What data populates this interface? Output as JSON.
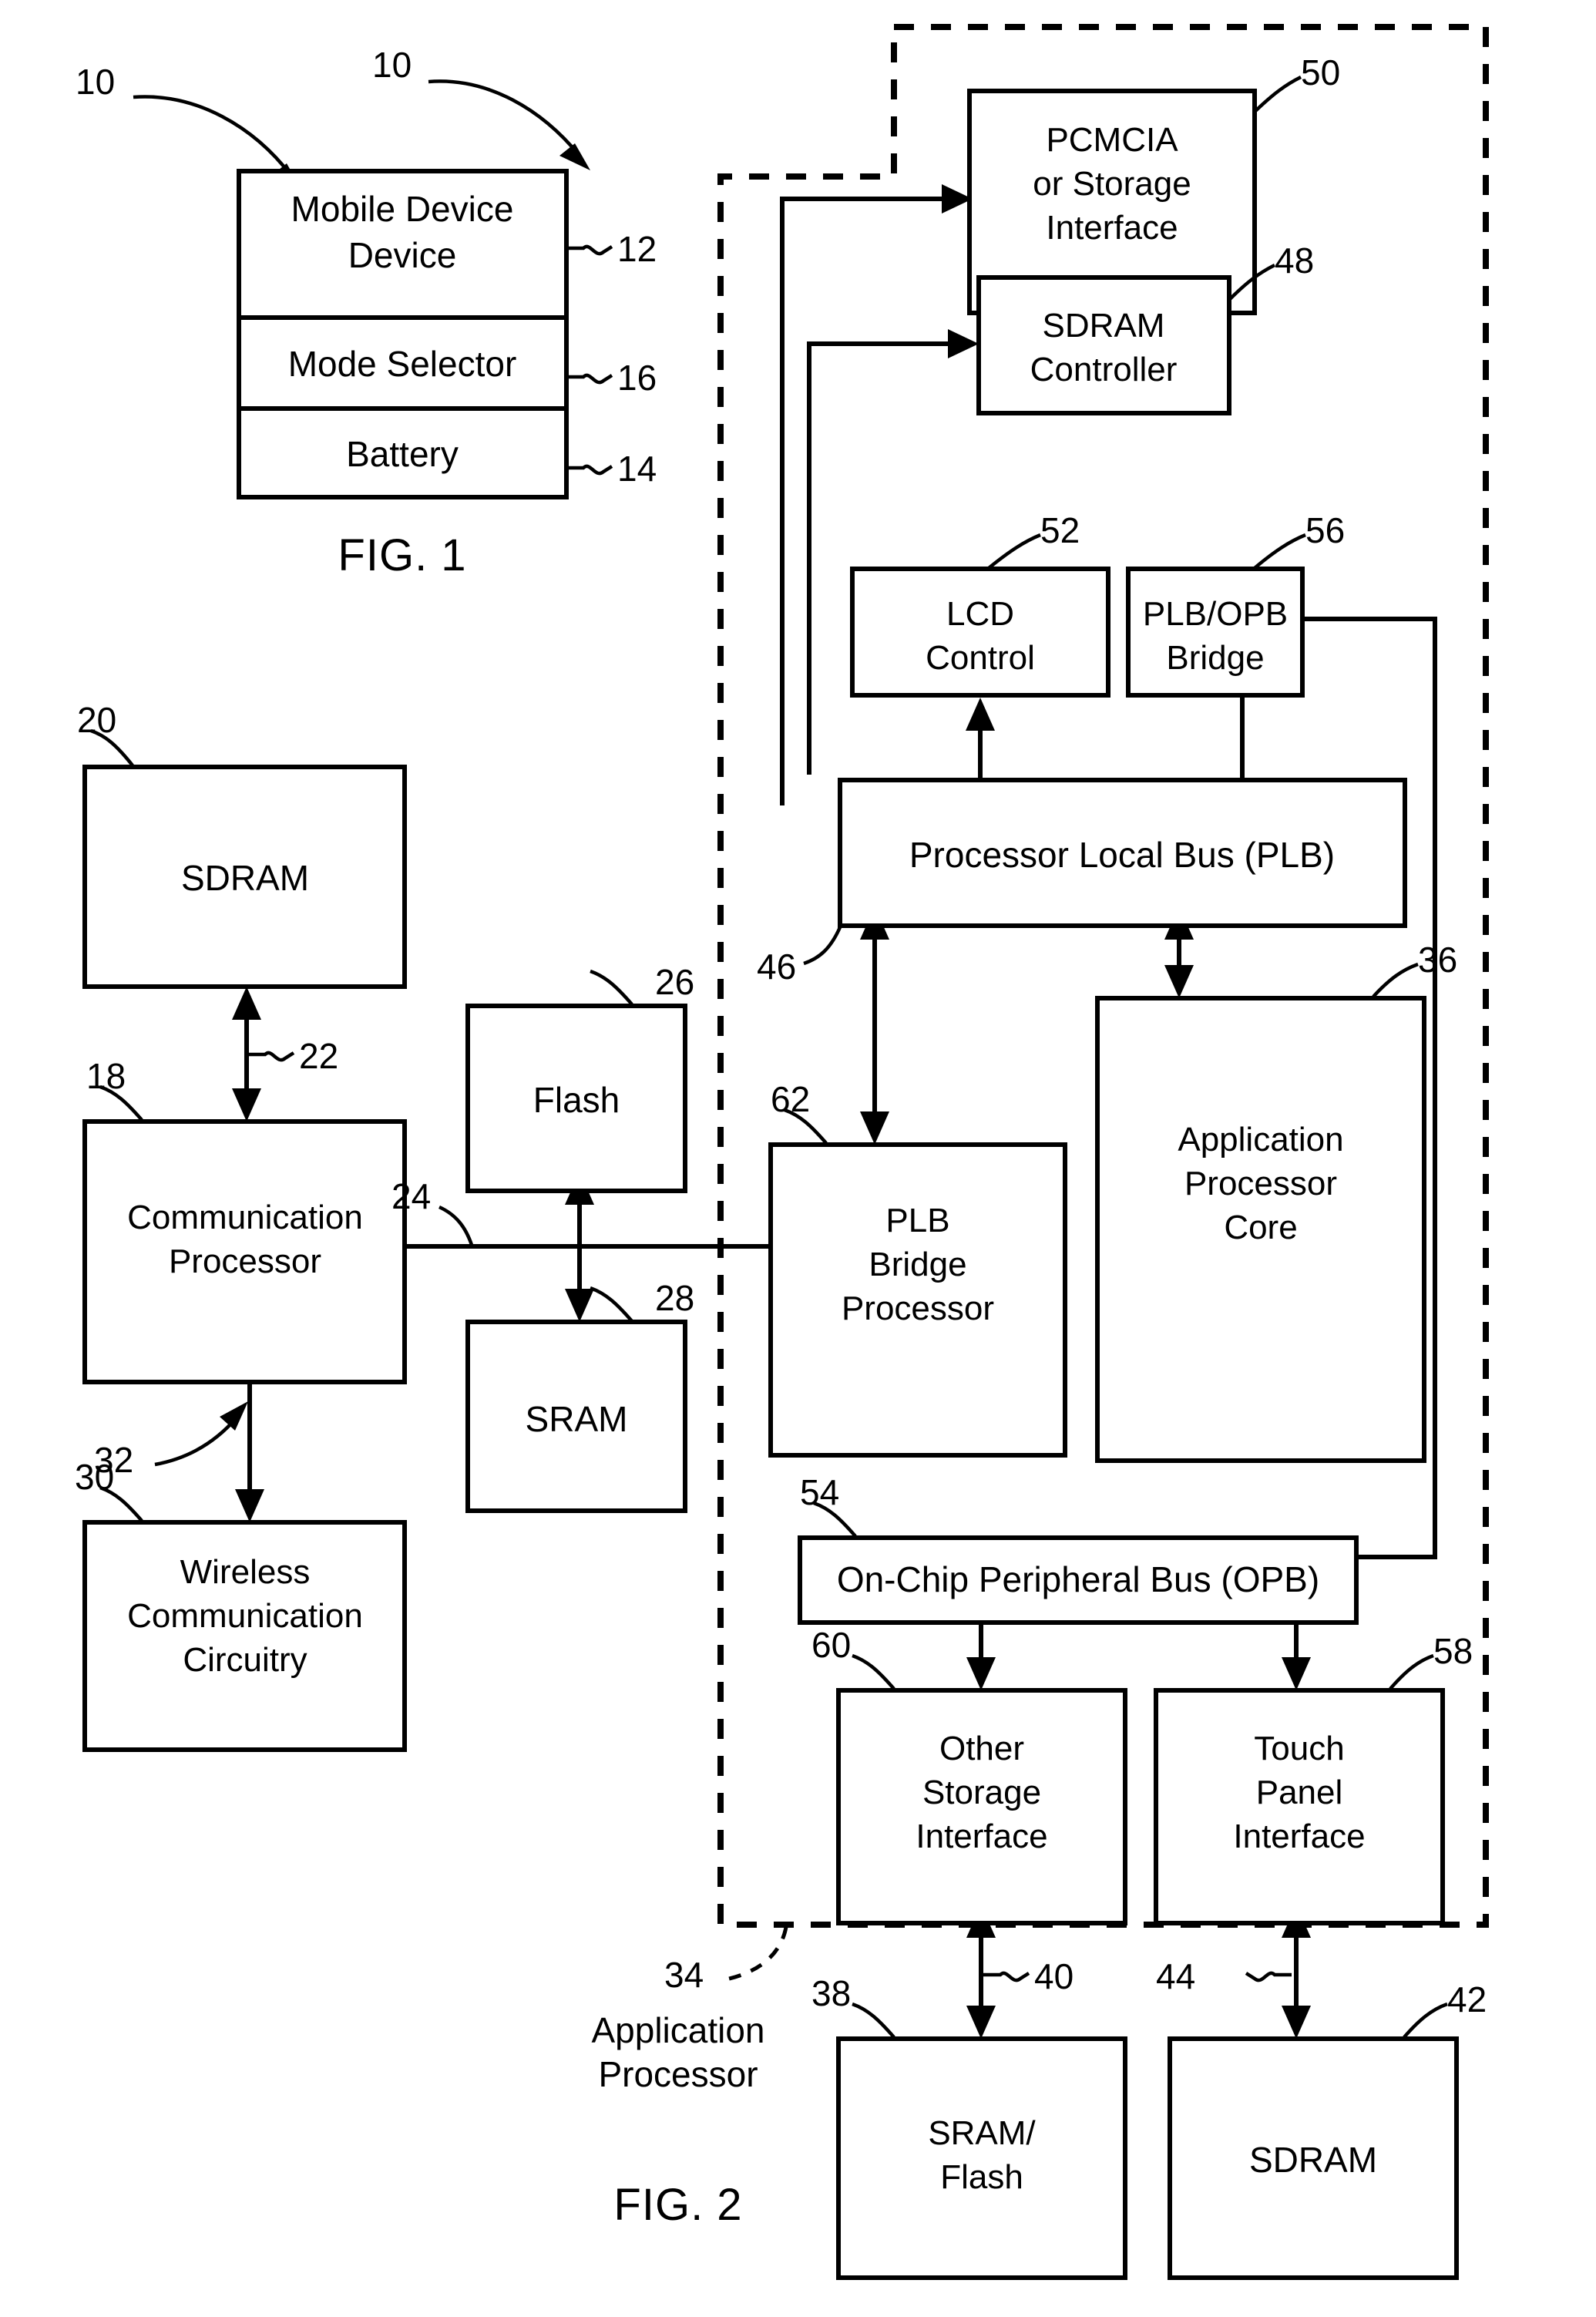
{
  "figures": [
    {
      "caption": "FIG. 1",
      "reference_arrow_label": "10",
      "blocks": [
        {
          "id": "mobile-device",
          "label": "Mobile Device",
          "ref": "12"
        },
        {
          "id": "mode-selector",
          "label": "Mode Selector",
          "ref": "16"
        },
        {
          "id": "battery",
          "label": "Battery",
          "ref": "14"
        }
      ]
    },
    {
      "caption": "FIG. 2",
      "reference_arrow_label": "10",
      "boundary_label": {
        "ref": "34",
        "line1": "Application",
        "line2": "Processor"
      },
      "blocks": [
        {
          "id": "pcmcia-storage-interface",
          "line1": "PCMCIA",
          "line2": "or Storage",
          "line3": "Interface",
          "ref": "50"
        },
        {
          "id": "sdram-controller",
          "line1": "SDRAM",
          "line2": "Controller",
          "ref": "48"
        },
        {
          "id": "lcd-control",
          "line1": "LCD",
          "line2": "Control",
          "ref": "52"
        },
        {
          "id": "plb-opb-bridge",
          "line1": "PLB/OPB",
          "line2": "Bridge",
          "ref": "56"
        },
        {
          "id": "processor-local-bus",
          "line1": "Processor Local Bus (PLB)",
          "ref": "46"
        },
        {
          "id": "sdram-left",
          "line1": "SDRAM",
          "ref": "20"
        },
        {
          "id": "flash",
          "line1": "Flash",
          "ref": "26"
        },
        {
          "id": "communication-processor",
          "line1": "Communication",
          "line2": "Processor",
          "ref": "18"
        },
        {
          "id": "sram",
          "line1": "SRAM",
          "ref": "28"
        },
        {
          "id": "wireless-communication-circuitry",
          "line1": "Wireless",
          "line2": "Communication",
          "line3": "Circuitry",
          "ref": "30"
        },
        {
          "id": "plb-bridge-processor",
          "line1": "PLB",
          "line2": "Bridge",
          "line3": "Processor",
          "ref": "62"
        },
        {
          "id": "application-processor-core",
          "line1": "Application",
          "line2": "Processor",
          "line3": "Core",
          "ref": "36"
        },
        {
          "id": "on-chip-peripheral-bus",
          "line1": "On-Chip Peripheral Bus (OPB)",
          "ref": "54"
        },
        {
          "id": "other-storage-interface",
          "line1": "Other",
          "line2": "Storage",
          "line3": "Interface",
          "ref": "60"
        },
        {
          "id": "touch-panel-interface",
          "line1": "Touch",
          "line2": "Panel",
          "line3": "Interface",
          "ref": "58"
        },
        {
          "id": "sram-flash",
          "line1": "SRAM/",
          "line2": "Flash",
          "ref": "38"
        },
        {
          "id": "sdram-bottom",
          "line1": "SDRAM",
          "ref": "42"
        }
      ],
      "connection_refs": [
        {
          "id": "link-sdram-commproc",
          "ref": "22"
        },
        {
          "id": "link-bus-24",
          "ref": "24"
        },
        {
          "id": "link-commproc-wireless",
          "ref": "32"
        },
        {
          "id": "link-sramflash-storage",
          "ref": "40"
        },
        {
          "id": "link-sdram-touchpanel",
          "ref": "44"
        }
      ]
    }
  ],
  "colors": {
    "ink": "#000000",
    "paper": "#ffffff"
  }
}
